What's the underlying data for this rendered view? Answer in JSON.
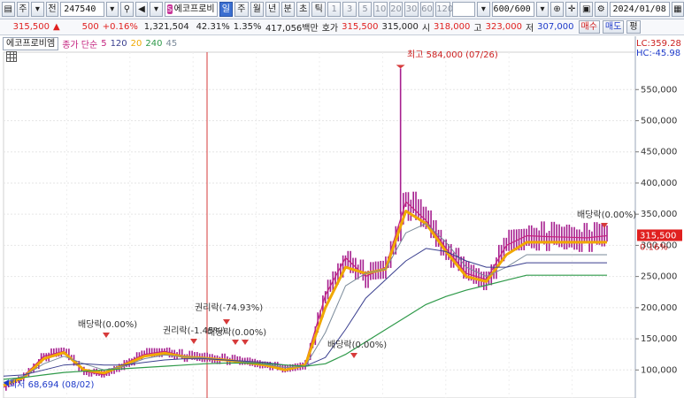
{
  "toolbar": {
    "menu_label": "주",
    "panel_label": "전",
    "code": "247540",
    "stock_name": "에코프로비",
    "periods": [
      "일",
      "주",
      "월",
      "년",
      "분",
      "초",
      "틱"
    ],
    "active_period": "일",
    "intervals": [
      "1",
      "3",
      "5",
      "10",
      "20",
      "30",
      "60",
      "120"
    ],
    "count_display": "600",
    "count_total": "/600",
    "date": "2024/01/08"
  },
  "quote": {
    "price": "315,500",
    "change": "500",
    "change_pct": "+0.16%",
    "volume": "1,321,504",
    "volume_ratio": "42.31%",
    "turnover_ratio": "1.35%",
    "amount": "417,056백만",
    "ask_label": "호가",
    "ask_value": "315,500",
    "bid_value": "315,000",
    "open_label": "시",
    "open_value": "318,000",
    "high_label": "고",
    "high_value": "323,000",
    "low_label": "저",
    "low_value": "307,000",
    "buy_label": "매수",
    "sell_label": "매도",
    "eval_label": "평"
  },
  "legend": {
    "name": "에코프로비엠",
    "line_label": "종가 단순",
    "ma": [
      "5",
      "120",
      "20",
      "240",
      "45"
    ]
  },
  "colors": {
    "up": "#e0201f",
    "down": "#1d39c9",
    "candle": "#a61f8f",
    "ma5": "#c4237f",
    "ma20": "#f0a800",
    "ma45": "#7a8a9a",
    "ma120": "#3a3f8f",
    "ma240": "#2f9a4a",
    "price_tag": "#e0201f"
  },
  "chart_data": {
    "type": "line",
    "title": "에코프로비엠",
    "ylim": [
      55000,
      610000
    ],
    "y_ticks": [
      100000,
      150000,
      200000,
      250000,
      300000,
      350000,
      400000,
      450000,
      500000,
      550000
    ],
    "y_tick_labels": [
      "100,000",
      "150,000",
      "200,000",
      "250,000",
      "300,000",
      "350,000",
      "400,000",
      "450,000",
      "500,000",
      "550,000"
    ],
    "x": [
      0,
      20,
      40,
      60,
      80,
      100,
      120,
      140,
      160,
      180,
      200,
      220,
      240,
      260,
      280,
      300,
      320,
      340,
      360,
      380,
      400,
      420,
      440,
      460,
      480,
      500,
      520,
      540,
      560,
      580,
      600
    ],
    "series": [
      {
        "name": "5",
        "values": [
          72000,
          90000,
          122000,
          130000,
          98000,
          92000,
          110000,
          125000,
          130000,
          122000,
          120000,
          117000,
          113000,
          110000,
          100000,
          110000,
          220000,
          280000,
          250000,
          265000,
          370000,
          340000,
          295000,
          255000,
          245000,
          300000,
          315500,
          314000,
          313000,
          312000,
          315500
        ]
      },
      {
        "name": "20",
        "values": [
          75000,
          88000,
          118000,
          128000,
          100000,
          95000,
          108000,
          122000,
          127000,
          121000,
          119000,
          116000,
          112000,
          108000,
          100000,
          108000,
          200000,
          265000,
          255000,
          262000,
          355000,
          335000,
          290000,
          250000,
          242000,
          285000,
          305000,
          305000,
          305000,
          305000,
          305000
        ]
      },
      {
        "name": "45",
        "values": [
          80000,
          90000,
          110000,
          122000,
          110000,
          100000,
          106000,
          118000,
          124000,
          121000,
          119000,
          116000,
          113000,
          109000,
          104000,
          106000,
          160000,
          235000,
          255000,
          262000,
          320000,
          335000,
          305000,
          265000,
          250000,
          265000,
          285000,
          285000,
          285000,
          285000,
          285000
        ]
      },
      {
        "name": "120",
        "values": [
          90000,
          92000,
          100000,
          108000,
          110000,
          108000,
          108000,
          112000,
          116000,
          118000,
          118000,
          116000,
          114000,
          112000,
          108000,
          106000,
          120000,
          165000,
          215000,
          245000,
          275000,
          295000,
          290000,
          275000,
          265000,
          265000,
          272000,
          272000,
          272000,
          272000,
          272000
        ]
      },
      {
        "name": "240",
        "values": [
          85000,
          88000,
          92000,
          96000,
          98000,
          100000,
          102000,
          104000,
          106000,
          108000,
          110000,
          111000,
          111000,
          110000,
          108000,
          106000,
          110000,
          125000,
          145000,
          165000,
          185000,
          205000,
          218000,
          228000,
          236000,
          244000,
          252000,
          252000,
          252000,
          252000,
          252000
        ]
      }
    ],
    "annotations": [
      {
        "text": "최고 584,000 (07/26)"
      },
      {
        "text": "최저 68,694 (08/02)"
      },
      {
        "text": "배당락(0.00%)"
      },
      {
        "text": "권리락(-1.45%)"
      },
      {
        "text": "권리락(-74.93%)"
      },
      {
        "text": "배당락(0.00%)"
      },
      {
        "text": "배당락(0.00%)"
      },
      {
        "text": "배당락(0.00%)"
      }
    ],
    "corner_labels": {
      "lc": "LC:359.28",
      "hc": "HC:-45.98"
    },
    "current_price_tag": "315,500",
    "current_pct_tag": "0.16%"
  }
}
